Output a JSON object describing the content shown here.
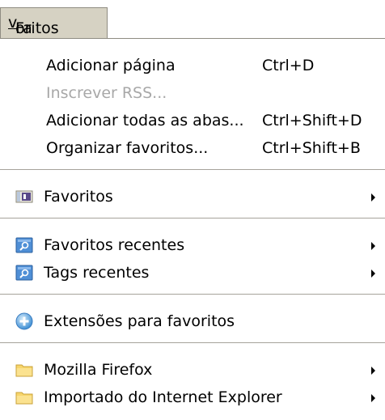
{
  "menubar": {
    "title_prefix": "Fa",
    "title_accel": "v",
    "title_suffix": "oritos"
  },
  "menu": {
    "add_page": {
      "label": "Adicionar página",
      "shortcut": "Ctrl+D"
    },
    "subscribe_rss": {
      "label": "Inscrever RSS..."
    },
    "add_all_tabs": {
      "label": "Adicionar todas as abas...",
      "shortcut": "Ctrl+Shift+D"
    },
    "organize": {
      "label": "Organizar favoritos...",
      "shortcut": "Ctrl+Shift+B"
    },
    "favorites_toolbar": {
      "label": "Favoritos",
      "icon": "bookmarks-toolbar-icon"
    },
    "recent_favorites": {
      "label": "Favoritos recentes",
      "icon": "smart-folder-icon"
    },
    "recent_tags": {
      "label": "Tags recentes",
      "icon": "smart-folder-icon"
    },
    "extensions": {
      "label": "Extensões para favoritos",
      "icon": "add-ons-icon"
    },
    "mozilla_firefox": {
      "label": "Mozilla Firefox",
      "icon": "folder-icon"
    },
    "imported_ie": {
      "label": "Importado do Internet Explorer",
      "icon": "folder-icon"
    }
  },
  "colors": {
    "menu_title_bg": "#d6d2c3",
    "disabled_text": "#a8a8a8",
    "separator": "#a6a39b",
    "folder_yellow": "#f7d56b",
    "smart_folder_blue": "#4f8fd6"
  }
}
